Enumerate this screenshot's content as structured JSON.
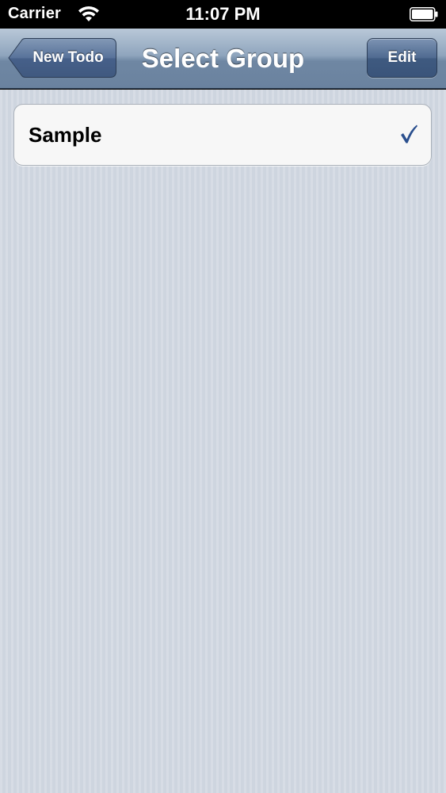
{
  "status_bar": {
    "carrier": "Carrier",
    "time": "11:07 PM",
    "wifi_icon": "wifi-icon",
    "battery_icon": "battery-icon"
  },
  "nav_bar": {
    "title": "Select Group",
    "back_label": "New Todo",
    "edit_label": "Edit"
  },
  "groups": [
    {
      "label": "Sample",
      "selected": true
    }
  ],
  "colors": {
    "checkmark": "#2a4f8e",
    "nav_bar": "#6f87a3",
    "background": "#ced5df"
  }
}
